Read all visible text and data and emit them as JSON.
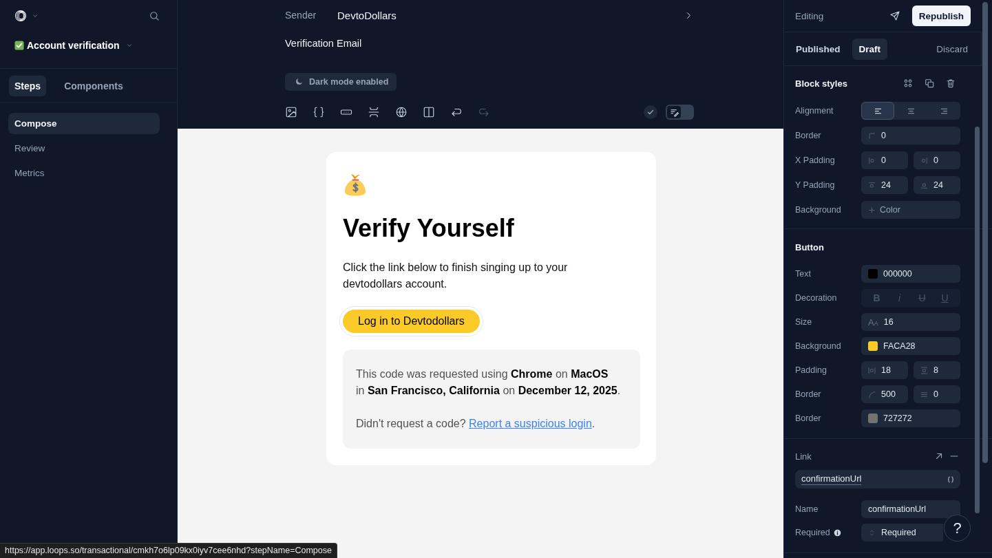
{
  "sidebar": {
    "title": "Account verification",
    "tabs": [
      {
        "label": "Steps",
        "selected": true
      },
      {
        "label": "Components",
        "selected": false
      }
    ],
    "steps": [
      {
        "label": "Compose",
        "selected": true
      },
      {
        "label": "Review",
        "selected": false
      },
      {
        "label": "Metrics",
        "selected": false
      }
    ]
  },
  "header": {
    "sender_label": "Sender",
    "sender": "DevtoDollars",
    "subject": "Verification Email",
    "dark_mode_button": "Dark mode enabled",
    "toolbar": [
      {
        "kind": "image",
        "disabled": false
      },
      {
        "kind": "variable",
        "disabled": false
      },
      {
        "kind": "button",
        "disabled": false
      },
      {
        "kind": "spacer",
        "disabled": false
      },
      {
        "kind": "web",
        "disabled": false
      },
      {
        "kind": "columns",
        "disabled": false
      },
      {
        "kind": "undo",
        "disabled": false
      },
      {
        "kind": "redo",
        "disabled": true
      }
    ],
    "preview_toggle": {
      "on": false
    }
  },
  "email": {
    "heading": "Verify Yourself",
    "body": "Click the link below to finish singing up to your devtodollars account.",
    "button": {
      "label": "Log in to Devtodollars",
      "selected": true
    },
    "notice": {
      "lines": [
        "This code was requested using **Chrome** on **MacOS**",
        "in **San Francisco, California** on **December 12, 2025**."
      ],
      "question": "Didn't request a code?",
      "link": "Report a suspicious login",
      "link_suffix": "."
    }
  },
  "inspector": {
    "mode": "Editing",
    "publish_button": "Republish",
    "version_tabs": [
      {
        "label": "Published",
        "selected": false
      },
      {
        "label": "Draft",
        "selected": true
      }
    ],
    "discard_button": "Discard",
    "block_styles": {
      "title": "Block styles",
      "rows": [
        {
          "kind": "align",
          "label": "Alignment",
          "options": [
            {
              "kind": "left",
              "selected": true
            },
            {
              "kind": "center",
              "selected": false
            },
            {
              "kind": "right",
              "selected": false
            }
          ]
        },
        {
          "kind": "fields",
          "label": "Border",
          "fields": [
            {
              "kind": "corner",
              "value": "0"
            }
          ]
        },
        {
          "kind": "fields",
          "label": "X Padding",
          "fields": [
            {
              "kind": "pad-left",
              "value": "0"
            },
            {
              "kind": "pad-right",
              "value": "0"
            }
          ]
        },
        {
          "kind": "fields",
          "label": "Y Padding",
          "fields": [
            {
              "kind": "pad-top",
              "value": "24"
            },
            {
              "kind": "pad-bottom",
              "value": "24"
            }
          ]
        },
        {
          "kind": "fields",
          "label": "Background",
          "fields": [
            {
              "kind": "add",
              "label": "Color"
            }
          ]
        }
      ]
    },
    "button_styles": {
      "title": "Button",
      "rows": [
        {
          "kind": "fields",
          "label": "Text",
          "fields": [
            {
              "kind": "swatch",
              "color": "#000000",
              "value": "000000"
            }
          ]
        },
        {
          "kind": "decoration",
          "label": "Decoration",
          "options": [
            {
              "kind": "bold",
              "label": "B",
              "active": false
            },
            {
              "kind": "italic",
              "label": "i",
              "active": false
            },
            {
              "kind": "strike",
              "label": "U",
              "active": false
            },
            {
              "kind": "underline",
              "label": "U",
              "active": false
            }
          ]
        },
        {
          "kind": "fields",
          "label": "Size",
          "fields": [
            {
              "kind": "font-size",
              "prefix": "AA",
              "value": "16"
            }
          ]
        },
        {
          "kind": "fields",
          "label": "Background",
          "fields": [
            {
              "kind": "swatch",
              "color": "#faca28",
              "value": "FACA28"
            }
          ]
        },
        {
          "kind": "fields",
          "label": "Padding",
          "fields": [
            {
              "kind": "pad-x",
              "value": "18"
            },
            {
              "kind": "pad-y",
              "value": "8"
            }
          ]
        },
        {
          "kind": "fields",
          "label": "Border",
          "fields": [
            {
              "kind": "radius",
              "value": "500"
            },
            {
              "kind": "width",
              "value": "0"
            }
          ]
        },
        {
          "kind": "fields",
          "label": "Border",
          "fields": [
            {
              "kind": "swatch",
              "color": "#727272",
              "value": "727272"
            }
          ]
        }
      ]
    },
    "link": {
      "title": "Link",
      "value": "confirmationUrl",
      "name_label": "Name",
      "name": "confirmationUrl",
      "required_label": "Required",
      "required": "Required"
    },
    "help_button": "?"
  },
  "status_url": "https://app.loops.so/transactional/cmkh7o6lp09kx0iyv7cee6nhd?stepName=Compose"
}
